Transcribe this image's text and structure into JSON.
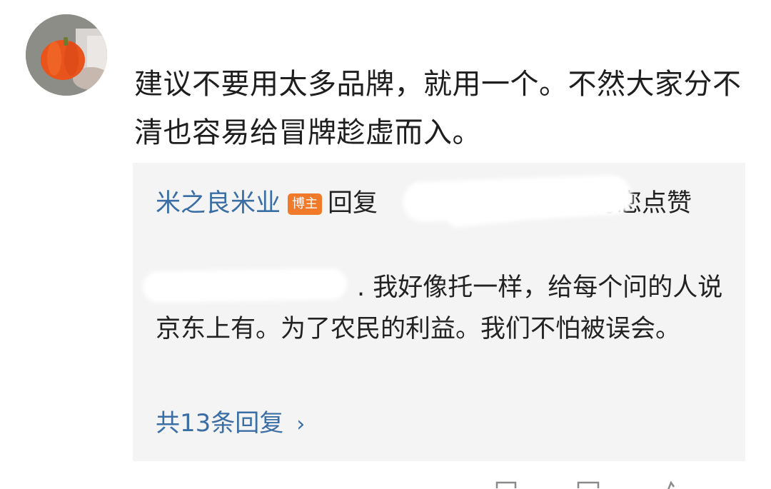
{
  "comment": {
    "text": "建议不要用太多品牌，就用一个。不然大家分不清也容易给冒牌趁虚而入。"
  },
  "reply": {
    "author_name": "米之良米业",
    "author_badge": "博主",
    "reply_prefix": "回复",
    "reply_suffix": "为您点赞",
    "body_text": ". 我好像托一样，给每个问的人说京东上有。为了农民的利益。我们不怕被误会。",
    "view_all_label": "共13条回复",
    "view_all_chevron": "›"
  },
  "colors": {
    "link_blue": "#3a6ea5",
    "badge_orange": "#f07a2a",
    "card_bg": "#f4f4f4"
  },
  "icons": {
    "avatar": "avatar-pumpkin",
    "view_all": "chevron-right-icon"
  }
}
